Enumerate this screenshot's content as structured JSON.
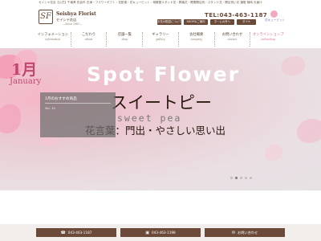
{
  "header": {
    "description": "セイシヤ花店【公式】千葉県 佐倉市 志津・フラワーギフト・花配達・花キューピット・胡蝶蘭スタンド花・葬儀花・開業開店祝・スタンド花・開店祝い花 通販 随時 お届け",
    "logo": {
      "mark": "SF",
      "name": "Seishya Florist",
      "sub": "セイシヤ花店",
      "sub2": "—Since 1967—"
    },
    "tel_label": "TEL:043-463-1187",
    "brand_badge": "花キューピット",
    "buttons": [
      {
        "label": "お花の配送について"
      },
      {
        "label": "SHOPのご案内"
      },
      {
        "label": "ホームの外へ"
      },
      {
        "label": "ダイヤ"
      }
    ]
  },
  "nav": {
    "items": [
      {
        "ja": "インフォメーション",
        "en": "information"
      },
      {
        "ja": "こだわり",
        "en": "about"
      },
      {
        "ja": "店舗一覧",
        "en": "shop"
      },
      {
        "ja": "ギャラリー",
        "en": "gallery"
      },
      {
        "ja": "会社概要",
        "en": "company"
      },
      {
        "ja": "お問い合わせ",
        "en": "contact"
      },
      {
        "ja": "オンラインショップ",
        "en": "onlineshop"
      }
    ]
  },
  "hero": {
    "month_num": "1月",
    "month_en": "January",
    "title": "Spot Flower",
    "flower_ja": "スイートピー",
    "flower_en": "sweet pea",
    "hanakotoba": "花言葉：門出・やさしい思い出",
    "colors": {
      "accent": "#c0486e",
      "title": "#ffffff"
    }
  },
  "card": {
    "title": "1月のおすすめ商品",
    "sub": "Vol. 10"
  },
  "slider": {
    "dot_count": 5,
    "active_index": 1
  },
  "footer": {
    "buttons": [
      {
        "icon": "phone-icon",
        "label": "043-463-1187"
      },
      {
        "icon": "fax-icon",
        "label": "043-463-1198"
      },
      {
        "icon": "mail-icon",
        "label": "お問い合わせ"
      }
    ]
  },
  "colors": {
    "brand_brown": "#6b4a3a",
    "nav_active": "#d76a93"
  }
}
